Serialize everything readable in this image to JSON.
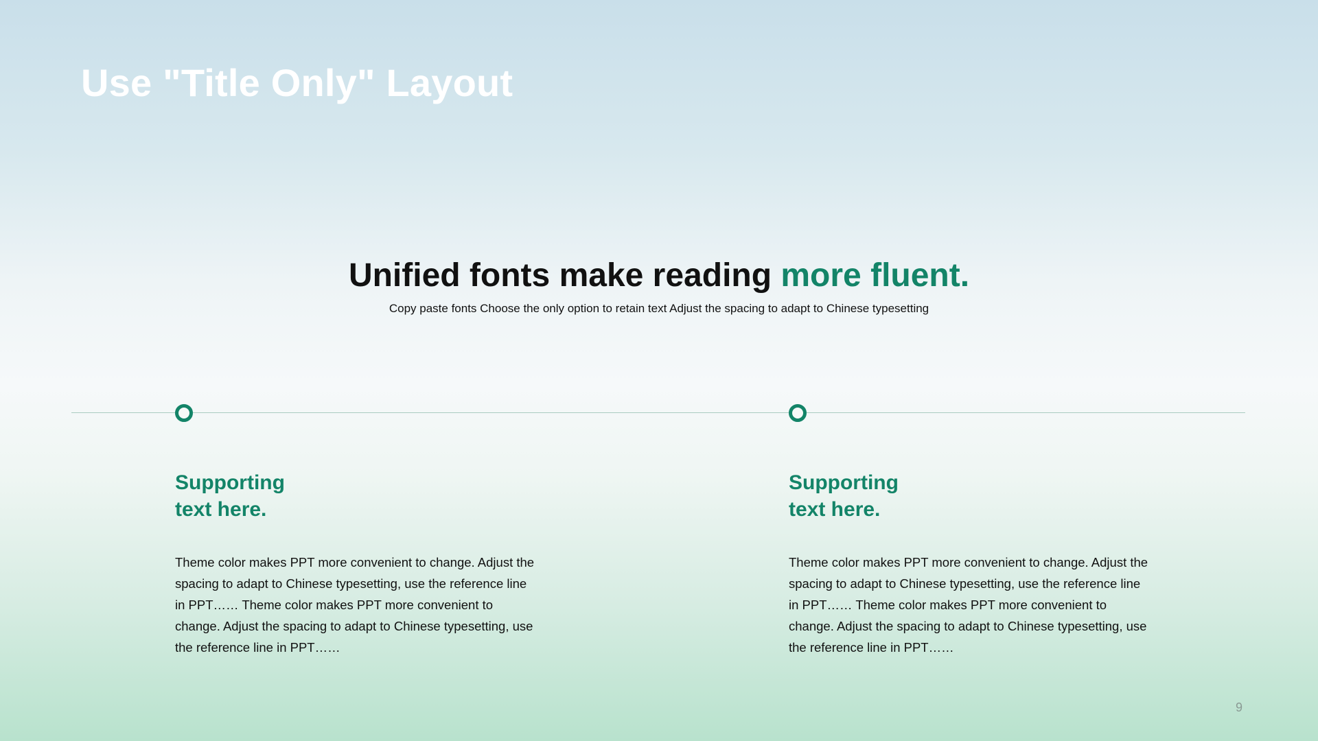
{
  "theme": {
    "accent": "#138468"
  },
  "title": "Use \"Title Only\" Layout",
  "headline": {
    "main": "Unified fonts make reading ",
    "accent": "more fluent."
  },
  "subline": "Copy paste fonts Choose the only option to retain text Adjust the spacing to adapt to Chinese typesetting",
  "columns": [
    {
      "heading": "Supporting text here.",
      "body": "Theme color makes PPT more convenient to change. Adjust the spacing to adapt to Chinese typesetting, use the reference line in PPT…… Theme color makes PPT more convenient to change. Adjust the spacing to adapt to Chinese typesetting, use the reference line in PPT……"
    },
    {
      "heading": "Supporting text here.",
      "body": "Theme color makes PPT more convenient to change. Adjust the spacing to adapt to Chinese typesetting, use the reference line in PPT…… Theme color makes PPT more convenient to change. Adjust the spacing to adapt to Chinese typesetting, use the reference line in PPT……"
    }
  ],
  "page_number": "9"
}
